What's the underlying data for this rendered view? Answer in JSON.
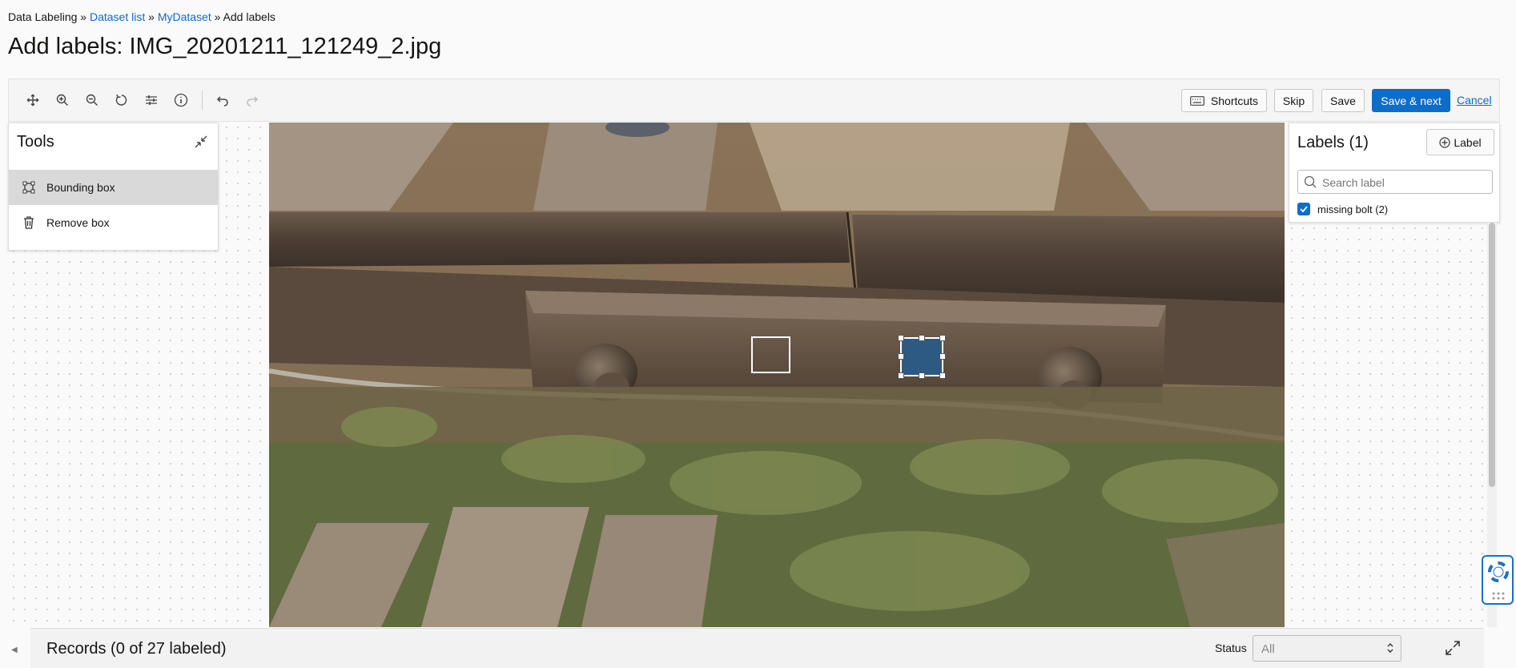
{
  "breadcrumb": {
    "items": [
      "Data Labeling",
      "Dataset list",
      "MyDataset",
      "Add labels"
    ],
    "separator": "»"
  },
  "page_title": "Add labels: IMG_20201211_121249_2.jpg",
  "toolbar": {
    "icons": [
      "move-icon",
      "zoom-in-icon",
      "zoom-out-icon",
      "reset-icon",
      "adjust-icon",
      "info-icon",
      "undo-icon",
      "redo-icon"
    ],
    "shortcuts_label": "Shortcuts",
    "skip_label": "Skip",
    "save_label": "Save",
    "save_next_label": "Save & next",
    "cancel_label": "Cancel"
  },
  "tools": {
    "title": "Tools",
    "items": [
      {
        "label": "Bounding box",
        "icon": "bounding-box-icon",
        "active": true
      },
      {
        "label": "Remove box",
        "icon": "trash-icon",
        "active": false
      }
    ]
  },
  "labels": {
    "title": "Labels (1)",
    "add_label": "Label",
    "search_placeholder": "Search label",
    "items": [
      {
        "label": "missing bolt (2)",
        "checked": true
      }
    ]
  },
  "footer": {
    "records": "Records (0 of 27 labeled)",
    "status_label": "Status",
    "status_value": "All"
  },
  "colors": {
    "primary": "#0d6dc8",
    "link": "#0b6ac9",
    "selected_box_fill": "#2d5a82"
  }
}
